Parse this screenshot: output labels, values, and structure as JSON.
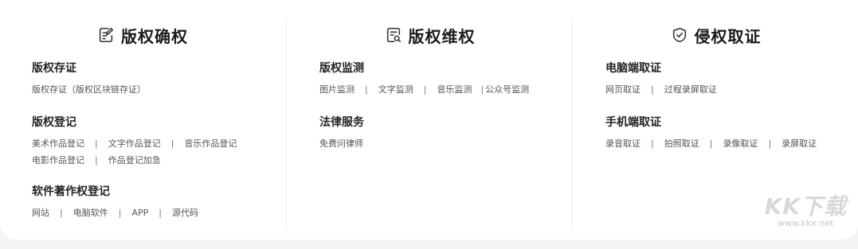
{
  "columns": [
    {
      "title": "版权确权",
      "icon": "document-edit-icon",
      "groups": [
        {
          "title": "版权存证",
          "links": [
            "版权存证（版权区块链存证）"
          ]
        },
        {
          "title": "版权登记",
          "links": [
            "美术作品登记",
            "文字作品登记",
            "音乐作品登记",
            "电影作品登记",
            "作品登记加急"
          ]
        },
        {
          "title": "软件著作权登记",
          "links": [
            "网站",
            "电脑软件",
            "APP",
            "源代码"
          ]
        }
      ]
    },
    {
      "title": "版权维权",
      "icon": "document-search-icon",
      "groups": [
        {
          "title": "版权监测",
          "links": [
            "图片监测",
            "文字监测",
            "音乐监测",
            "公众号监测"
          ]
        },
        {
          "title": "法律服务",
          "links": [
            "免费问律师"
          ]
        }
      ]
    },
    {
      "title": "侵权取证",
      "icon": "shield-check-icon",
      "groups": [
        {
          "title": "电脑端取证",
          "links": [
            "网页取证",
            "过程录屏取证"
          ]
        },
        {
          "title": "手机端取证",
          "links": [
            "录音取证",
            "拍照取证",
            "录像取证",
            "录屏取证"
          ]
        }
      ]
    }
  ],
  "separator": "|",
  "watermark": {
    "logo": "KK下载",
    "url": "www.kkx.net"
  }
}
